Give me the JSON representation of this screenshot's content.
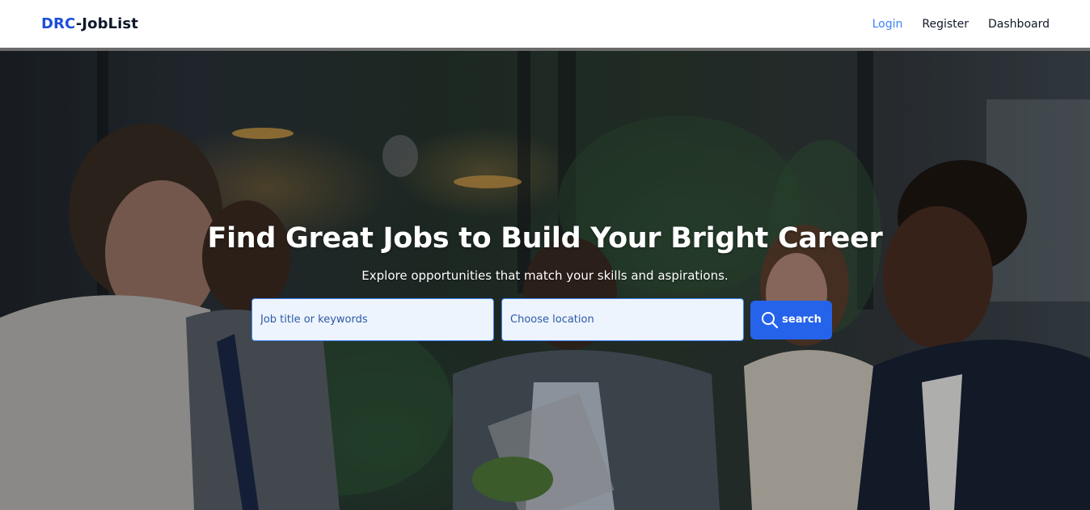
{
  "navbar": {
    "brand_accent": "DRC",
    "brand_rest": "-JobList",
    "links": [
      {
        "label": "Login",
        "active": true
      },
      {
        "label": "Register",
        "active": false
      },
      {
        "label": "Dashboard",
        "active": false
      }
    ]
  },
  "hero": {
    "title": "Find Great Jobs to Build Your Bright Career",
    "subtitle": "Explore opportunities that match your skills and aspirations.",
    "image_description": "office-team-meeting-photo"
  },
  "search": {
    "keywords_placeholder": "Job title or keywords",
    "location_placeholder": "Choose location",
    "button_label": "search",
    "button_icon": "search-icon"
  },
  "colors": {
    "brand_accent": "#1d4ed8",
    "active_link": "#3b82f6",
    "button": "#2563eb",
    "field_background": "#eef4fd"
  }
}
